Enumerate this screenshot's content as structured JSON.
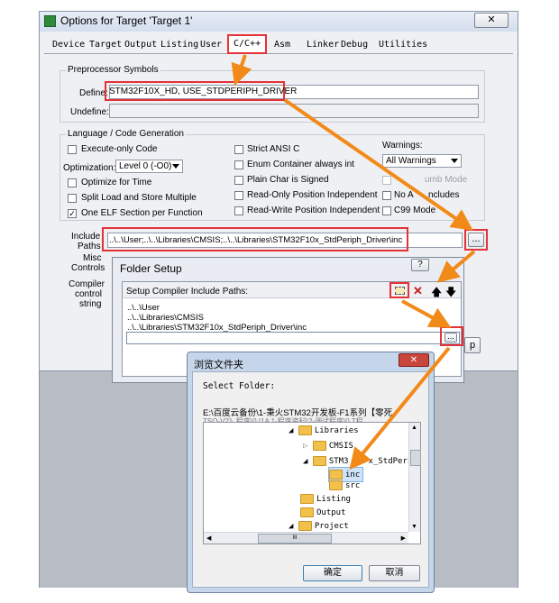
{
  "window": {
    "title": "Options for Target 'Target 1'",
    "close_glyph": "✕",
    "icon": "keil-icon"
  },
  "tabs": [
    "Device",
    "Target",
    "Output",
    "Listing",
    "User",
    "C/C++",
    "Asm",
    "Linker",
    "Debug",
    "Utilities"
  ],
  "preprocessor": {
    "title": "Preprocessor Symbols",
    "define_label": "Define:",
    "define_value": "STM32F10X_HD, USE_STDPERIPH_DRIVER",
    "undefine_label": "Undefine:",
    "undefine_value": ""
  },
  "codegen": {
    "title": "Language / Code Generation",
    "execute_only": "Execute-only Code",
    "optimization_label": "Optimization:",
    "optimization_value": "Level 0 (-O0)",
    "optimize_time": "Optimize for Time",
    "split_load": "Split Load and Store Multiple",
    "one_elf": "One ELF Section per Function",
    "strict_ansi": "Strict ANSI C",
    "enum_container": "Enum Container always int",
    "plain_char": "Plain Char is Signed",
    "readonly_pi": "Read-Only Position Independent",
    "readwrite_pi": "Read-Write Position Independent",
    "warnings_label": "Warnings:",
    "warnings_value": "All Warnings",
    "thumb_mode": "umb Mode",
    "no_auto": "No A",
    "no_auto_tail": "ncludes",
    "c99": "C99 Mode"
  },
  "include": {
    "label1": "Include",
    "label2": "Paths",
    "value": "..\\..\\User;..\\..\\Libraries\\CMSIS;..\\..\\Libraries\\STM32F10x_StdPeriph_Driver\\inc",
    "browse": "..."
  },
  "misc": {
    "label1": "Misc",
    "label2": "Controls"
  },
  "compiler": {
    "label1": "Compiler",
    "label2": "control",
    "label3": "string"
  },
  "folder_setup": {
    "title": "Folder Setup",
    "help": "?",
    "subtitle": "Setup Compiler Include Paths:",
    "paths": [
      "..\\..\\User",
      "..\\..\\Libraries\\CMSIS",
      "..\\..\\Libraries\\STM32F10x_StdPeriph_Driver\\inc"
    ],
    "browse": "...",
    "help_btn_partial": "p"
  },
  "browse_dialog": {
    "title": "浏览文件夹",
    "select_label": "Select Folder:",
    "path_line1": "E:\\百度云备份\\1-秉火STM32开发板-F1系列【零死",
    "path_line2": "TSO-V2》程序\\0 I1A 1-程序资料\\2-调试程序\\0 T程",
    "tree": [
      "Libraries",
      "CMSIS",
      "STM3",
      "x_StdPerip",
      "inc",
      "src",
      "Listing",
      "Output",
      "Project"
    ],
    "scroll_mid": "III",
    "ok": "确定",
    "cancel": "取消"
  }
}
